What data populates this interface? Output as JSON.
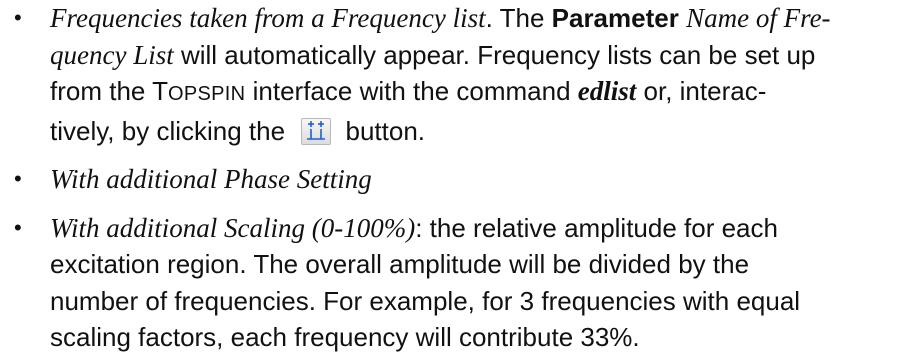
{
  "items": [
    {
      "p1_italic": "Frequencies taken from a Frequency list",
      "p2": ". The ",
      "p3_bold": "Parameter",
      "p4": " ",
      "p5_italic": "Name of Fre-",
      "p6_italic": "quency List",
      "p7": " will automatically appear. Frequency lists can be set up from the ",
      "p8_smallcaps_first": "T",
      "p8_smallcaps_rest": "OPSPIN",
      "p9": " interface with the command ",
      "p10_bolditalic": "edlist",
      "p11": " or, interac-",
      "p12": "tively, by clicking the ",
      "p13": " button.",
      "button_icon": "frequency-list-toolbar-icon"
    },
    {
      "p1_italic": "With additional Phase Setting"
    },
    {
      "p1_italic": "With additional Scaling (0-100%)",
      "p2": ": the relative amplitude for each",
      "p3": "excitation region. The overall amplitude will be divided by the",
      "p4": "number of frequencies. For example, for 3 frequencies with equal",
      "p5": "scaling factors, each frequency will contribute 33%."
    }
  ],
  "bullet": "•",
  "colors": {
    "text": "#111111",
    "icon_blue": "#1f5fd6"
  }
}
